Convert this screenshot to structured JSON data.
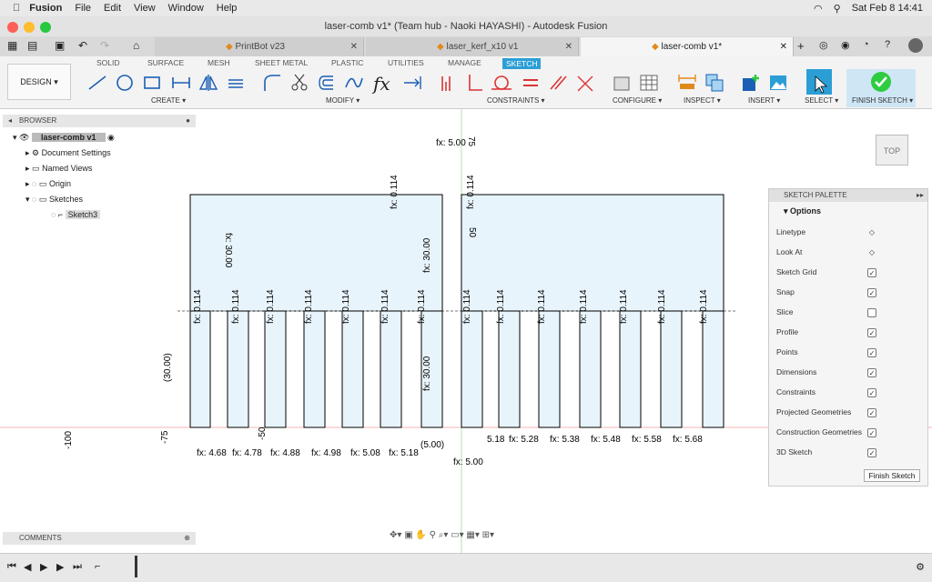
{
  "menubar": {
    "app": "Fusion",
    "items": [
      "File",
      "Edit",
      "View",
      "Window",
      "Help"
    ],
    "clock": "Sat Feb 8  14:41"
  },
  "window": {
    "title": "laser-comb v1* (Team hub - Naoki HAYASHI) - Autodesk Fusion"
  },
  "tabs": [
    {
      "label": "PrintBot v23"
    },
    {
      "label": "laser_kerf_x10 v1"
    },
    {
      "label": "laser-comb v1*"
    }
  ],
  "ribbon": {
    "workspace": "DESIGN ▾",
    "tabs": [
      "SOLID",
      "SURFACE",
      "MESH",
      "SHEET METAL",
      "PLASTIC",
      "UTILITIES",
      "MANAGE",
      "SKETCH"
    ],
    "groups": [
      "CREATE ▾",
      "MODIFY ▾",
      "CONSTRAINTS ▾",
      "CONFIGURE ▾",
      "INSPECT ▾",
      "INSERT ▾",
      "SELECT ▾",
      "FINISH SKETCH ▾"
    ]
  },
  "browser": {
    "title": "BROWSER",
    "items": [
      {
        "label": "laser-comb v1"
      },
      {
        "label": "Document Settings"
      },
      {
        "label": "Named Views"
      },
      {
        "label": "Origin"
      },
      {
        "label": "Sketches"
      },
      {
        "label": "Sketch3"
      }
    ]
  },
  "palette": {
    "title": "SKETCH PALETTE",
    "section": "Options",
    "rows": [
      {
        "label": "Linetype",
        "checked": null
      },
      {
        "label": "Look At",
        "checked": null
      },
      {
        "label": "Sketch Grid",
        "checked": true
      },
      {
        "label": "Snap",
        "checked": true
      },
      {
        "label": "Slice",
        "checked": false
      },
      {
        "label": "Profile",
        "checked": true
      },
      {
        "label": "Points",
        "checked": true
      },
      {
        "label": "Dimensions",
        "checked": true
      },
      {
        "label": "Constraints",
        "checked": true
      },
      {
        "label": "Projected Geometries",
        "checked": true
      },
      {
        "label": "Construction Geometries",
        "checked": true
      },
      {
        "label": "3D Sketch",
        "checked": true
      }
    ],
    "finish": "Finish Sketch"
  },
  "comments": {
    "title": "COMMENTS"
  },
  "viewcube": {
    "face": "TOP"
  },
  "sketch": {
    "top_dim": "fx: 5.00",
    "bottom_dim": "fx: 5.00",
    "left_height": "fx: 30.00",
    "mid_height": "fx: 30.00",
    "lower_height": "fx: 30.00",
    "ref_dim": "(30.00)",
    "ref_small": "(5.00)",
    "kerf": "fx: 0.114",
    "axis_labels": [
      "75",
      "-75",
      "-100",
      "-50",
      "50"
    ],
    "left_widths": [
      "fx: 4.68",
      "fx: 4.78",
      "fx: 4.88",
      "fx: 4.98",
      "fx: 5.08",
      "fx: 5.18"
    ],
    "right_widths": [
      "5.18",
      "fx: 5.28",
      "fx: 5.38",
      "fx: 5.48",
      "fx: 5.58",
      "fx: 5.68"
    ]
  },
  "colors": {
    "accent": "#2c9ed6",
    "finish": "#2ecc40",
    "fill": "#e8f4fb"
  }
}
